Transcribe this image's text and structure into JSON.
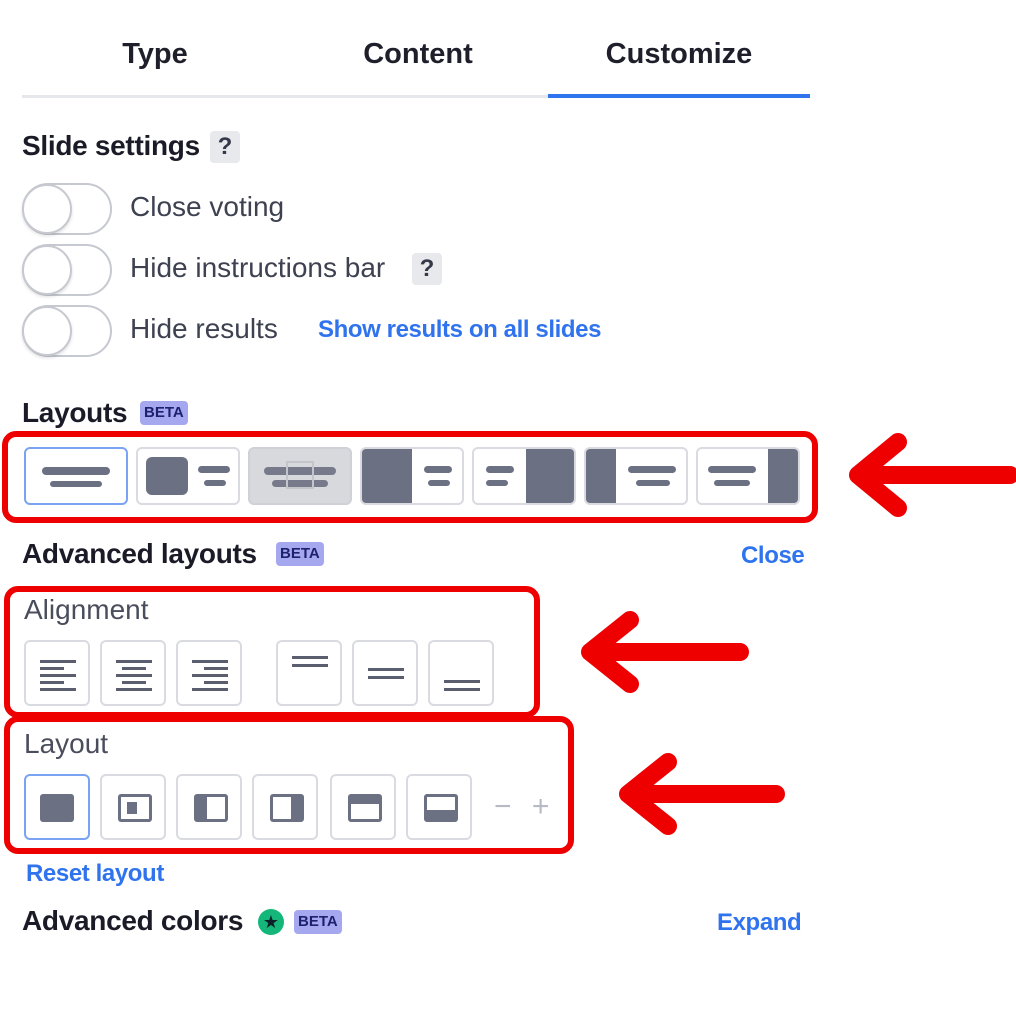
{
  "tabs": [
    {
      "label": "Type"
    },
    {
      "label": "Content"
    },
    {
      "label": "Customize",
      "active": true
    }
  ],
  "slide_settings": {
    "title": "Slide settings",
    "help": "?",
    "toggles": [
      {
        "label": "Close voting",
        "on": false
      },
      {
        "label": "Hide instructions bar",
        "on": false,
        "help": "?"
      },
      {
        "label": "Hide results",
        "on": false
      }
    ],
    "show_results_link": "Show results on all slides"
  },
  "layouts": {
    "title": "Layouts",
    "badge": "BETA",
    "options": [
      {
        "icon": "text-top-layout-icon",
        "selected": true
      },
      {
        "icon": "image-left-text-layout-icon"
      },
      {
        "icon": "image-background-layout-icon",
        "disabled": true
      },
      {
        "icon": "image-left-large-layout-icon"
      },
      {
        "icon": "image-right-large-layout-icon"
      },
      {
        "icon": "image-left-strip-layout-icon"
      },
      {
        "icon": "image-right-strip-layout-icon"
      }
    ]
  },
  "advanced_layouts": {
    "title": "Advanced layouts",
    "badge": "BETA",
    "close_link": "Close",
    "alignment": {
      "title": "Alignment",
      "options": [
        "align-left-icon",
        "align-center-icon",
        "align-right-icon",
        "align-top-icon",
        "align-middle-icon",
        "align-bottom-icon"
      ]
    },
    "layout": {
      "title": "Layout",
      "options": [
        "full-layout-icon",
        "centered-layout-icon",
        "left-panel-layout-icon",
        "right-panel-layout-icon",
        "top-panel-layout-icon",
        "bottom-panel-layout-icon"
      ],
      "stepper": "− +"
    },
    "reset_link": "Reset layout"
  },
  "advanced_colors": {
    "title": "Advanced colors",
    "badge": "BETA",
    "expand_link": "Expand"
  },
  "colors": {
    "accent": "#2f73ee",
    "annotation": "#ee0000",
    "beta_badge": "#a5a7ef",
    "premium_star": "#14b779"
  }
}
